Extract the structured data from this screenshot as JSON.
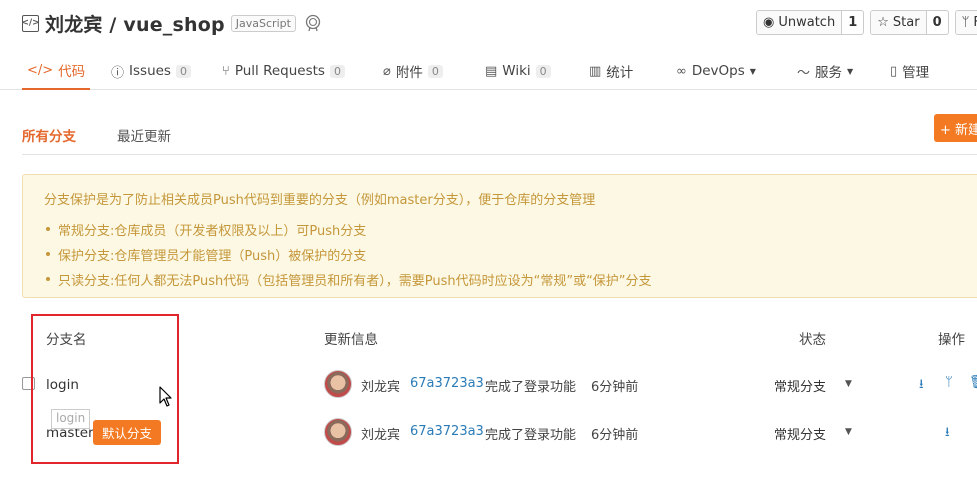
{
  "repo": {
    "owner": "刘龙宾",
    "separator": " / ",
    "name": "vue_shop",
    "language": "JavaScript",
    "icon": "repo-icon",
    "badge_icon": "certificate-icon"
  },
  "actions": {
    "watch": {
      "label": "Unwatch",
      "count": "1",
      "icon": "eye-icon"
    },
    "star": {
      "label": "Star",
      "count": "0",
      "icon": "star-icon"
    },
    "fork": {
      "label": "F",
      "icon": "fork-icon"
    }
  },
  "tabs": [
    {
      "label": "代码",
      "icon": "code-icon",
      "active": true
    },
    {
      "label": "Issues",
      "count": "0",
      "icon": "info-icon"
    },
    {
      "label": "Pull Requests",
      "count": "0",
      "icon": "pull-request-icon"
    },
    {
      "label": "附件",
      "count": "0",
      "icon": "paperclip-icon"
    },
    {
      "label": "Wiki",
      "count": "0",
      "icon": "book-icon"
    },
    {
      "label": "统计",
      "icon": "bar-chart-icon"
    },
    {
      "label": "DevOps",
      "icon": "infinity-icon",
      "dropdown": true
    },
    {
      "label": "服务",
      "icon": "pulse-icon",
      "dropdown": true
    },
    {
      "label": "管理",
      "icon": "document-icon"
    }
  ],
  "subtabs": {
    "all": "所有分支",
    "recent": "最近更新",
    "new_button": "+ 新建"
  },
  "notice": {
    "head": "分支保护是为了防止相关成员Push代码到重要的分支（例如master分支），便于仓库的分支管理",
    "items": [
      "常规分支:仓库成员（开发者权限及以上）可Push分支",
      "保护分支:仓库管理员才能管理（Push）被保护的分支",
      "只读分支:任何人都无法Push代码（包括管理员和所有者），需要Push代码时应设为“常规”或“保护”分支"
    ]
  },
  "table": {
    "headers": {
      "name": "分支名",
      "info": "更新信息",
      "status": "状态",
      "ops": "操作"
    },
    "rows": [
      {
        "name": "login",
        "author": "刘龙宾",
        "sha": "67a3723a3",
        "message": "完成了登录功能",
        "ago": "6分钟前",
        "status": "常规分支"
      },
      {
        "name": "master",
        "author": "刘龙宾",
        "sha": "67a3723a3",
        "message": "完成了登录功能",
        "ago": "6分钟前",
        "status": "常规分支",
        "default_label": "默认分支"
      }
    ]
  },
  "tooltip": "login",
  "colors": {
    "accent": "#e4682c",
    "button": "#f37a22",
    "link": "#2a7bb7",
    "highlight": "#e0262c"
  }
}
